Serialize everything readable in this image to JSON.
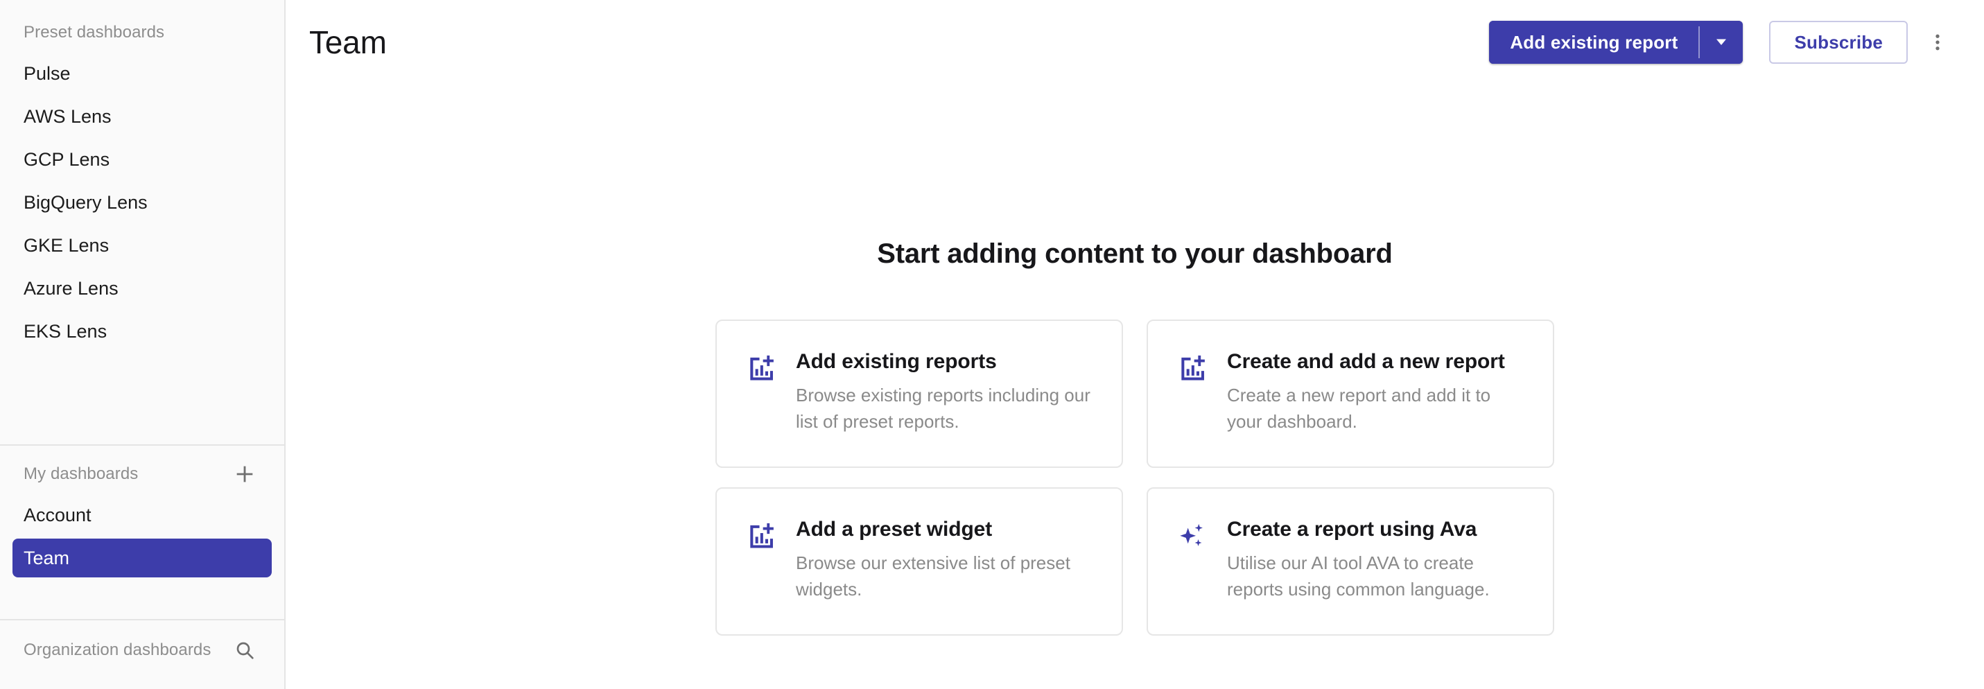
{
  "colors": {
    "accent": "#3d3daa",
    "sidebar_bg": "#fafafa",
    "border": "#e4e4e4",
    "muted_text": "#8a8a8a"
  },
  "sidebar": {
    "preset_section": {
      "heading": "Preset dashboards",
      "items": [
        {
          "label": "Pulse",
          "selected": false
        },
        {
          "label": "AWS Lens",
          "selected": false
        },
        {
          "label": "GCP Lens",
          "selected": false
        },
        {
          "label": "BigQuery Lens",
          "selected": false
        },
        {
          "label": "GKE Lens",
          "selected": false
        },
        {
          "label": "Azure Lens",
          "selected": false
        },
        {
          "label": "EKS Lens",
          "selected": false
        }
      ]
    },
    "my_section": {
      "heading": "My dashboards",
      "add_icon": "plus-icon",
      "items": [
        {
          "label": "Account",
          "selected": false
        },
        {
          "label": "Team",
          "selected": true
        }
      ]
    },
    "org_section": {
      "heading": "Organization dashboards",
      "search_icon": "search-icon"
    }
  },
  "header": {
    "title": "Team",
    "add_existing_report_label": "Add existing report",
    "dropdown_icon": "chevron-down-icon",
    "subscribe_label": "Subscribe",
    "more_icon": "kebab-menu-icon"
  },
  "empty_state": {
    "title": "Start adding content to your dashboard",
    "cards": [
      {
        "icon": "add-chart-icon",
        "title": "Add existing reports",
        "description": "Browse existing reports including our list of preset reports."
      },
      {
        "icon": "add-chart-icon",
        "title": "Create and add a new report",
        "description": "Create a new report and add it to your dashboard."
      },
      {
        "icon": "add-chart-icon",
        "title": "Add a preset widget",
        "description": "Browse our extensive list of preset widgets."
      },
      {
        "icon": "sparkle-ai-icon",
        "title": "Create a report using Ava",
        "description": "Utilise our AI tool AVA to create reports using common language."
      }
    ]
  }
}
